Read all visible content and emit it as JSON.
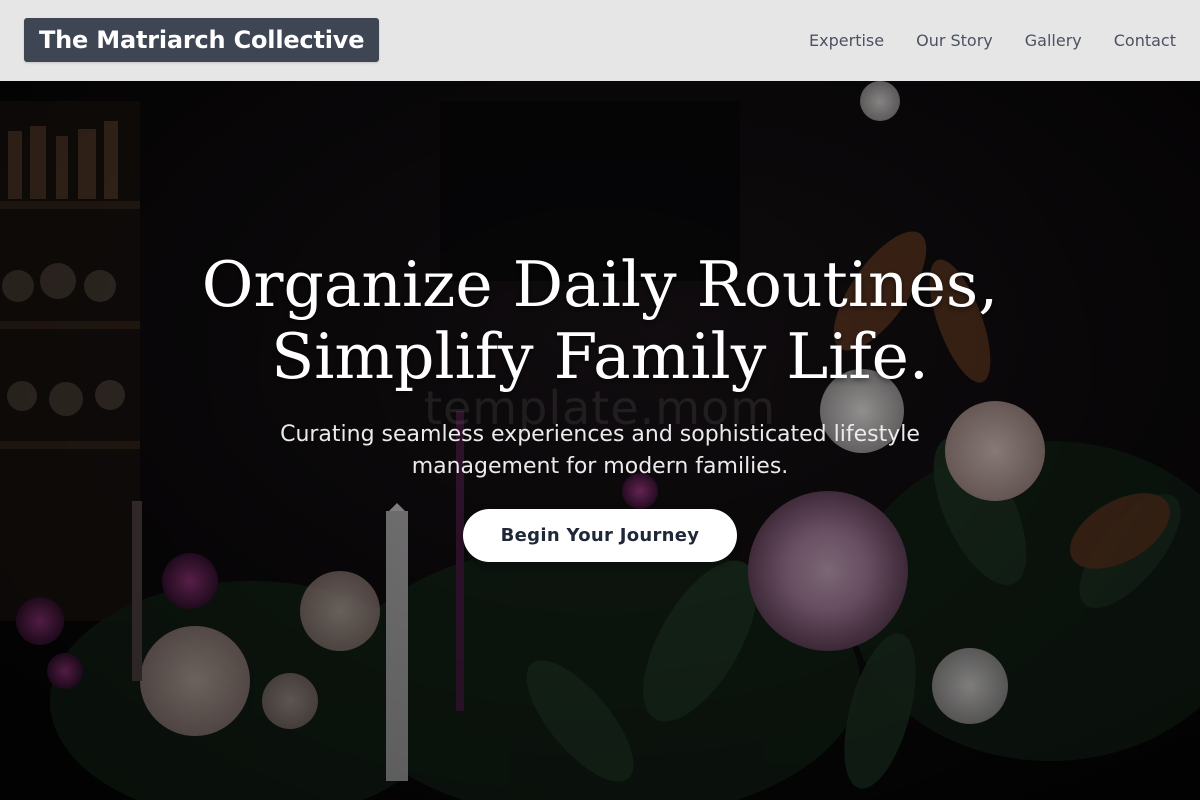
{
  "header": {
    "brand": "The Matriarch Collective",
    "nav": [
      "Expertise",
      "Our Story",
      "Gallery",
      "Contact"
    ]
  },
  "hero": {
    "title_line1": "Organize Daily Routines,",
    "title_line2": "Simplify Family Life.",
    "watermark": "template.mom",
    "subtitle": "Curating seamless experiences and sophisticated lifestyle management for modern families.",
    "cta_label": "Begin Your Journey"
  },
  "colors": {
    "header_bg": "#e6e6e6",
    "brand_bg": "#3f4653",
    "nav_text": "#4b5260",
    "cta_text": "#1e2838"
  }
}
